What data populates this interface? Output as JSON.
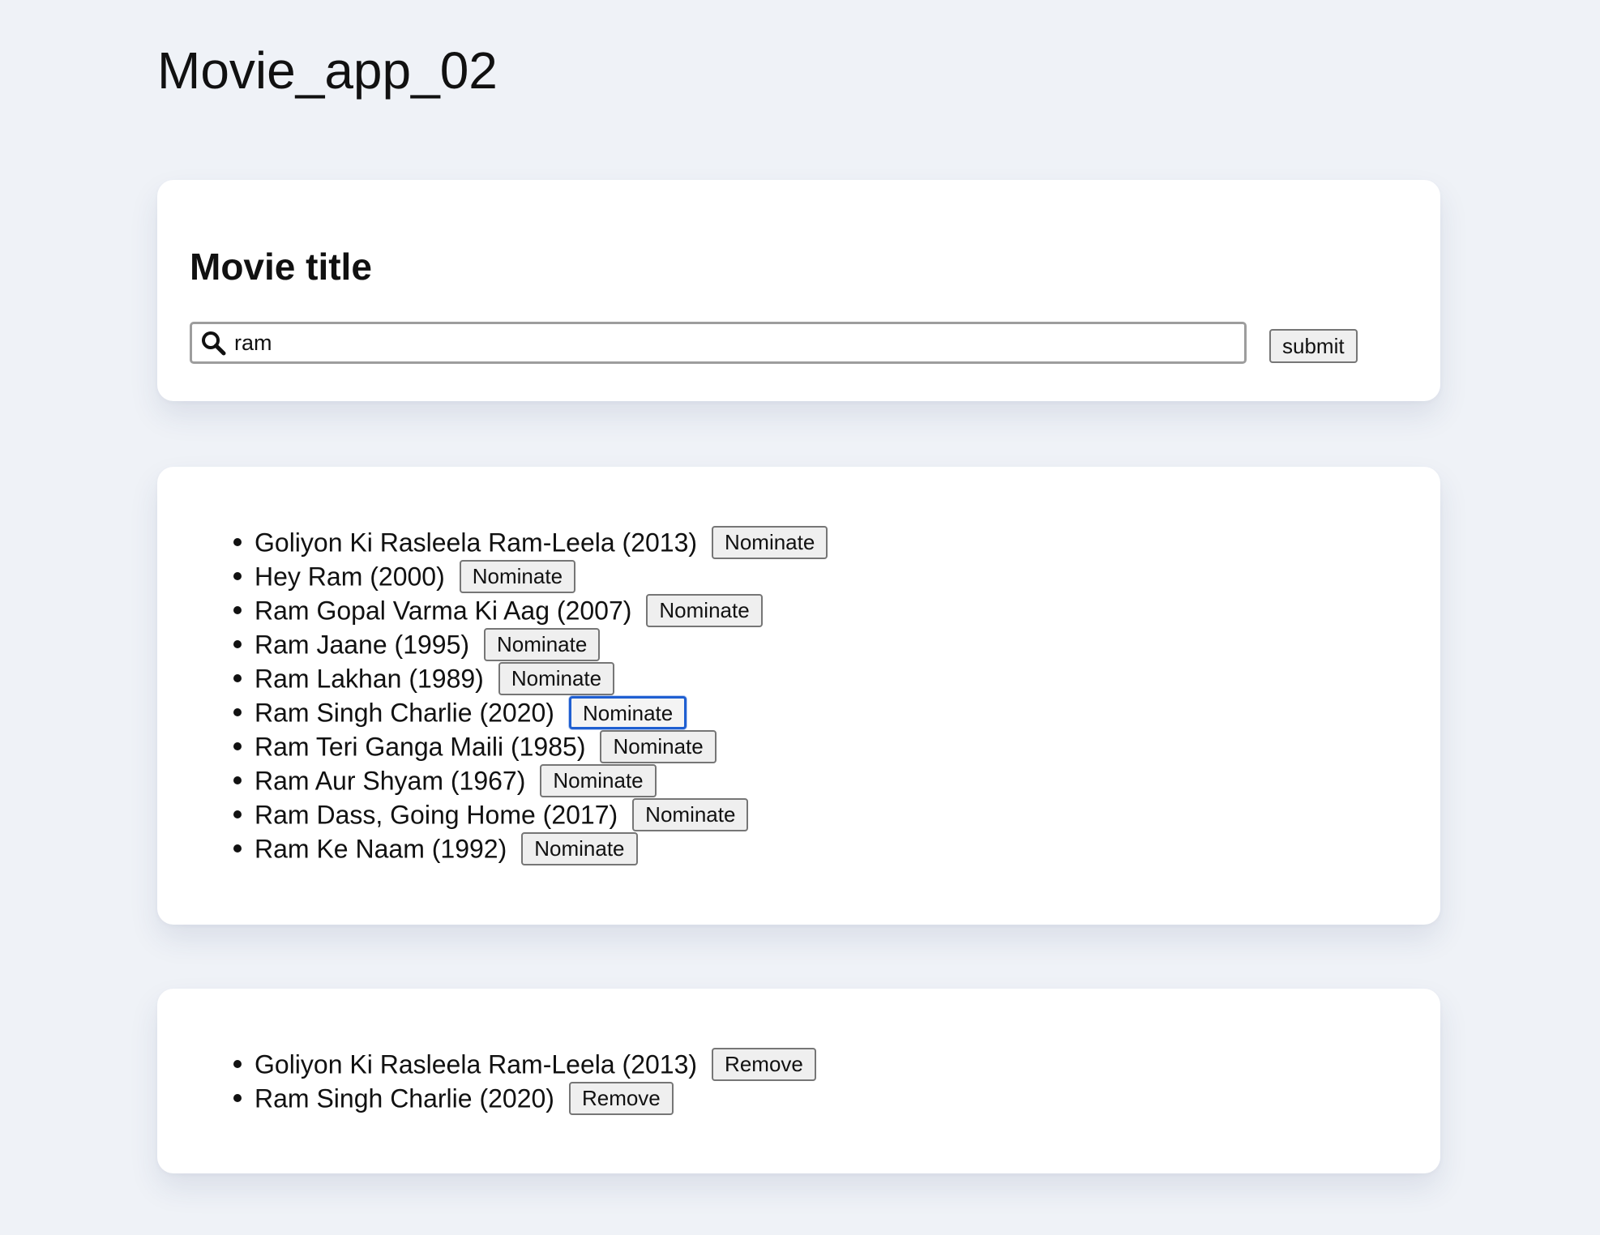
{
  "app": {
    "title": "Movie_app_02"
  },
  "search": {
    "heading": "Movie title",
    "value": "ram",
    "submit_label": "submit"
  },
  "results": [
    {
      "title": "Goliyon Ki Rasleela Ram-Leela (2013)",
      "button": "Nominate"
    },
    {
      "title": "Hey Ram (2000)",
      "button": "Nominate"
    },
    {
      "title": "Ram Gopal Varma Ki Aag (2007)",
      "button": "Nominate"
    },
    {
      "title": "Ram Jaane (1995)",
      "button": "Nominate"
    },
    {
      "title": "Ram Lakhan (1989)",
      "button": "Nominate"
    },
    {
      "title": "Ram Singh Charlie (2020)",
      "button": "Nominate"
    },
    {
      "title": "Ram Teri Ganga Maili (1985)",
      "button": "Nominate"
    },
    {
      "title": "Ram Aur Shyam (1967)",
      "button": "Nominate"
    },
    {
      "title": "Ram Dass, Going Home (2017)",
      "button": "Nominate"
    },
    {
      "title": "Ram Ke Naam (1992)",
      "button": "Nominate"
    }
  ],
  "nominations": [
    {
      "title": "Goliyon Ki Rasleela Ram-Leela (2013)",
      "button": "Remove"
    },
    {
      "title": "Ram Singh Charlie (2020)",
      "button": "Remove"
    }
  ],
  "colors": {
    "page_background": "#eff2f7",
    "card_background": "#ffffff",
    "focus_ring": "#1f5fd1"
  },
  "icons": {
    "search": "search-icon"
  }
}
